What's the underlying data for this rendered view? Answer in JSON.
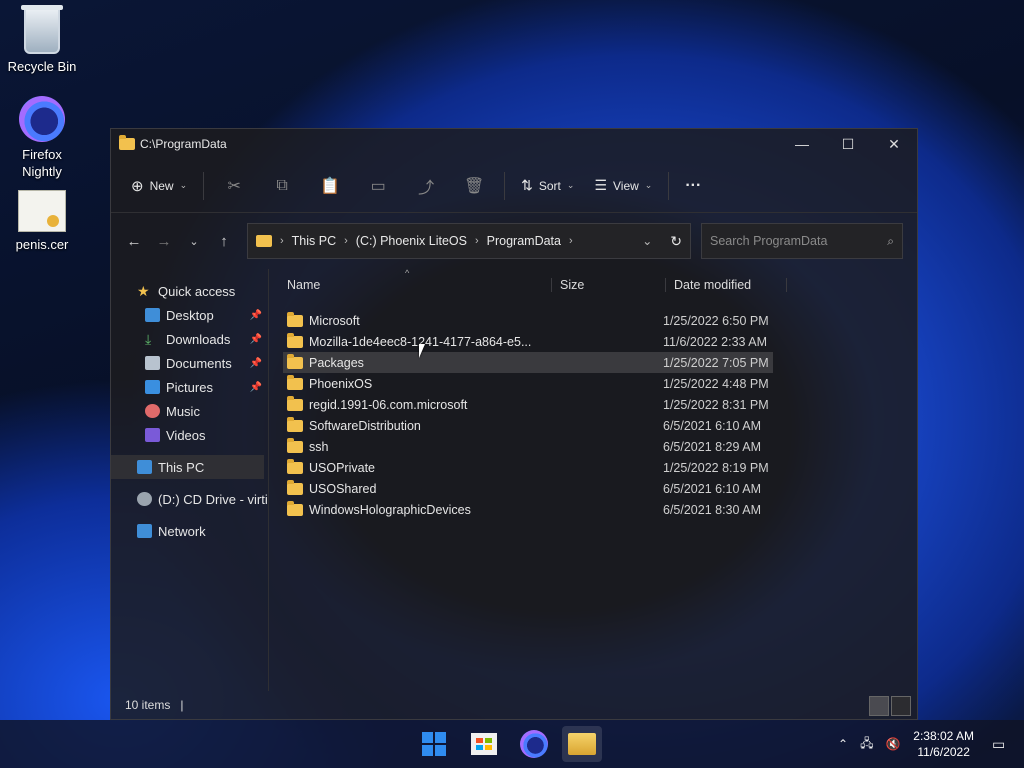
{
  "desktop": {
    "icons": [
      {
        "label": "Recycle Bin"
      },
      {
        "label": "Firefox\nNightly"
      },
      {
        "label": "penis.cer"
      }
    ]
  },
  "window": {
    "title": "C:\\ProgramData",
    "controls": {
      "minimize": "—",
      "maximize": "☐",
      "close": "✕"
    }
  },
  "toolbar": {
    "new_label": "New",
    "sort_label": "Sort",
    "view_label": "View",
    "more": "···"
  },
  "address": {
    "crumbs": [
      "This PC",
      "(C:) Phoenix LiteOS",
      "ProgramData"
    ]
  },
  "search": {
    "placeholder": "Search ProgramData"
  },
  "sidebar": {
    "quick_access": "Quick access",
    "items": [
      "Desktop",
      "Downloads",
      "Documents",
      "Pictures",
      "Music",
      "Videos"
    ],
    "this_pc": "This PC",
    "cd_drive": "(D:) CD Drive - virti",
    "network": "Network"
  },
  "columns": {
    "name": "Name",
    "size": "Size",
    "date": "Date modified"
  },
  "files": [
    {
      "name": "Microsoft",
      "date": "1/25/2022 6:50 PM"
    },
    {
      "name": "Mozilla-1de4eec8-1241-4177-a864-e5...",
      "date": "11/6/2022 2:33 AM"
    },
    {
      "name": "Packages",
      "date": "1/25/2022 7:05 PM"
    },
    {
      "name": "PhoenixOS",
      "date": "1/25/2022 4:48 PM"
    },
    {
      "name": "regid.1991-06.com.microsoft",
      "date": "1/25/2022 8:31 PM"
    },
    {
      "name": "SoftwareDistribution",
      "date": "6/5/2021 6:10 AM"
    },
    {
      "name": "ssh",
      "date": "6/5/2021 8:29 AM"
    },
    {
      "name": "USOPrivate",
      "date": "1/25/2022 8:19 PM"
    },
    {
      "name": "USOShared",
      "date": "6/5/2021 6:10 AM"
    },
    {
      "name": "WindowsHolographicDevices",
      "date": "6/5/2021 8:30 AM"
    }
  ],
  "status": {
    "count": "10 items",
    "sep": "|"
  },
  "taskbar": {
    "time": "2:38:02 AM",
    "date": "11/6/2022"
  },
  "colors": {
    "folder": "#f2c14e",
    "accent": "#2f8cf0"
  }
}
